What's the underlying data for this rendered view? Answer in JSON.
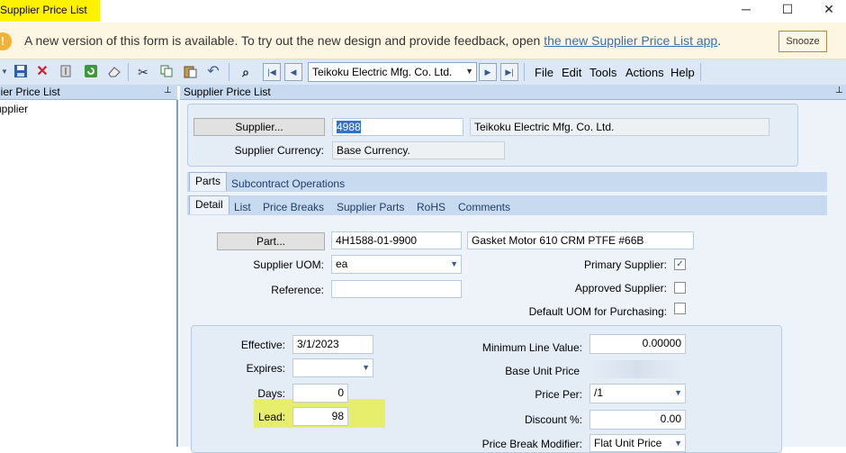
{
  "window": {
    "title": "Supplier Price List",
    "minimize": "─",
    "maximize": "☐",
    "close": "✕"
  },
  "notification": {
    "icon": "!",
    "text": "A new version of this form is available. To try out the new design and provide feedback, open ",
    "link": "the new Supplier Price List app",
    "suffix": ".",
    "snooze": "Snooze"
  },
  "toolbar": {
    "supplier_selected": "Teikoku Electric Mfg. Co. Ltd.",
    "menus": [
      "File",
      "Edit",
      "Tools",
      "Actions",
      "Help"
    ]
  },
  "tree": {
    "header": "lier Price List",
    "item": "upplier"
  },
  "main_header": "Supplier Price List",
  "supplier": {
    "button": "Supplier...",
    "id": "4988",
    "name": "Teikoku Electric Mfg. Co. Ltd.",
    "currency_label": "Supplier Currency:",
    "currency": "Base Currency."
  },
  "tabs_main": [
    "Parts",
    "Subcontract Operations"
  ],
  "tabs_sub": [
    "Detail",
    "List",
    "Price Breaks",
    "Supplier Parts",
    "RoHS",
    "Comments"
  ],
  "part": {
    "button": "Part...",
    "number": "4H1588-01-9900",
    "description": "Gasket Motor 610 CRM PTFE #66B",
    "uom_label": "Supplier UOM:",
    "uom": "ea",
    "reference_label": "Reference:",
    "reference": "",
    "primary_label": "Primary Supplier:",
    "approved_label": "Approved Supplier:",
    "default_uom_label": "Default UOM for Purchasing:",
    "primary_checked": "✓"
  },
  "pricing": {
    "effective_label": "Effective:",
    "effective": "3/1/2023",
    "expires_label": "Expires:",
    "expires": "",
    "days_label": "Days:",
    "days": "0",
    "lead_label": "Lead:",
    "lead": "98",
    "min_line_label": "Minimum Line Value:",
    "min_line": "0.00000",
    "base_unit_label": "Base Unit Price",
    "price_per_label": "Price Per:",
    "price_per": "/1",
    "discount_label": "Discount %:",
    "discount": "0.00",
    "modifier_label": "Price Break Modifier:",
    "modifier": "Flat Unit Price"
  }
}
